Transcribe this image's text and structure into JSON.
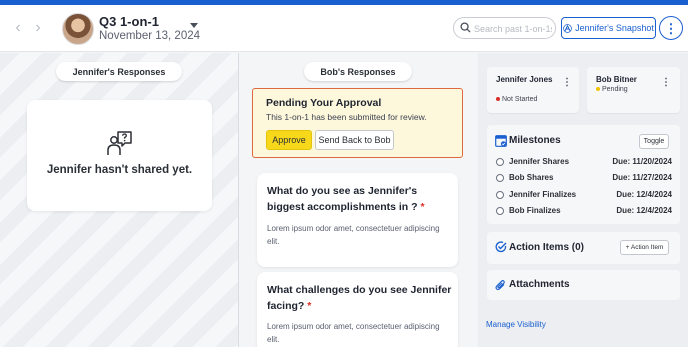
{
  "header": {
    "title": "Q3 1-on-1",
    "date": "November 13, 2024",
    "search_placeholder": "Search past 1-on-1s",
    "snapshot_label": "Jennifer's Snapshot",
    "more_glyph": "⋮",
    "back_glyph": "‹",
    "forward_glyph": "›"
  },
  "left": {
    "header_label": "Jennifer's Responses",
    "empty_message": "Jennifer hasn't shared yet."
  },
  "middle": {
    "header_label": "Bob's Responses",
    "approval": {
      "title": "Pending Your Approval",
      "subtitle": "This 1-on-1 has been submitted for review.",
      "approve_label": "Approve",
      "send_back_label": "Send Back to Bob"
    },
    "questions": [
      {
        "text": "What do you see as Jennifer's biggest accomplishments in ?",
        "required_mark": "*",
        "answer": "Lorem ipsum odor amet, consectetuer adipiscing elit."
      },
      {
        "text": "What challenges do you see Jennifer facing?",
        "required_mark": "*",
        "answer": "Lorem ipsum odor amet, consectetuer adipiscing elit."
      }
    ]
  },
  "right": {
    "participants": [
      {
        "name": "Jennifer Jones",
        "status": "Not Started",
        "status_color": "#d93025"
      },
      {
        "name": "Bob Bitner",
        "status": "Pending",
        "status_color": "#f2c200"
      }
    ],
    "milestones": {
      "title": "Milestones",
      "toggle_label": "Toggle",
      "items": [
        {
          "label": "Jennifer Shares",
          "due": "Due: 11/20/2024"
        },
        {
          "label": "Bob Shares",
          "due": "Due: 11/27/2024"
        },
        {
          "label": "Jennifer Finalizes",
          "due": "Due: 12/4/2024"
        },
        {
          "label": "Bob Finalizes",
          "due": "Due: 12/4/2024"
        }
      ]
    },
    "action_items": {
      "title": "Action Items (0)",
      "add_label": "+ Action Item"
    },
    "attachments": {
      "title": "Attachments"
    },
    "manage_visibility": "Manage Visibility"
  },
  "colors": {
    "accent": "#1a5fd0",
    "approve": "#f7d81a",
    "alert_border": "#e0683f",
    "alert_bg": "#fdf7dc"
  }
}
